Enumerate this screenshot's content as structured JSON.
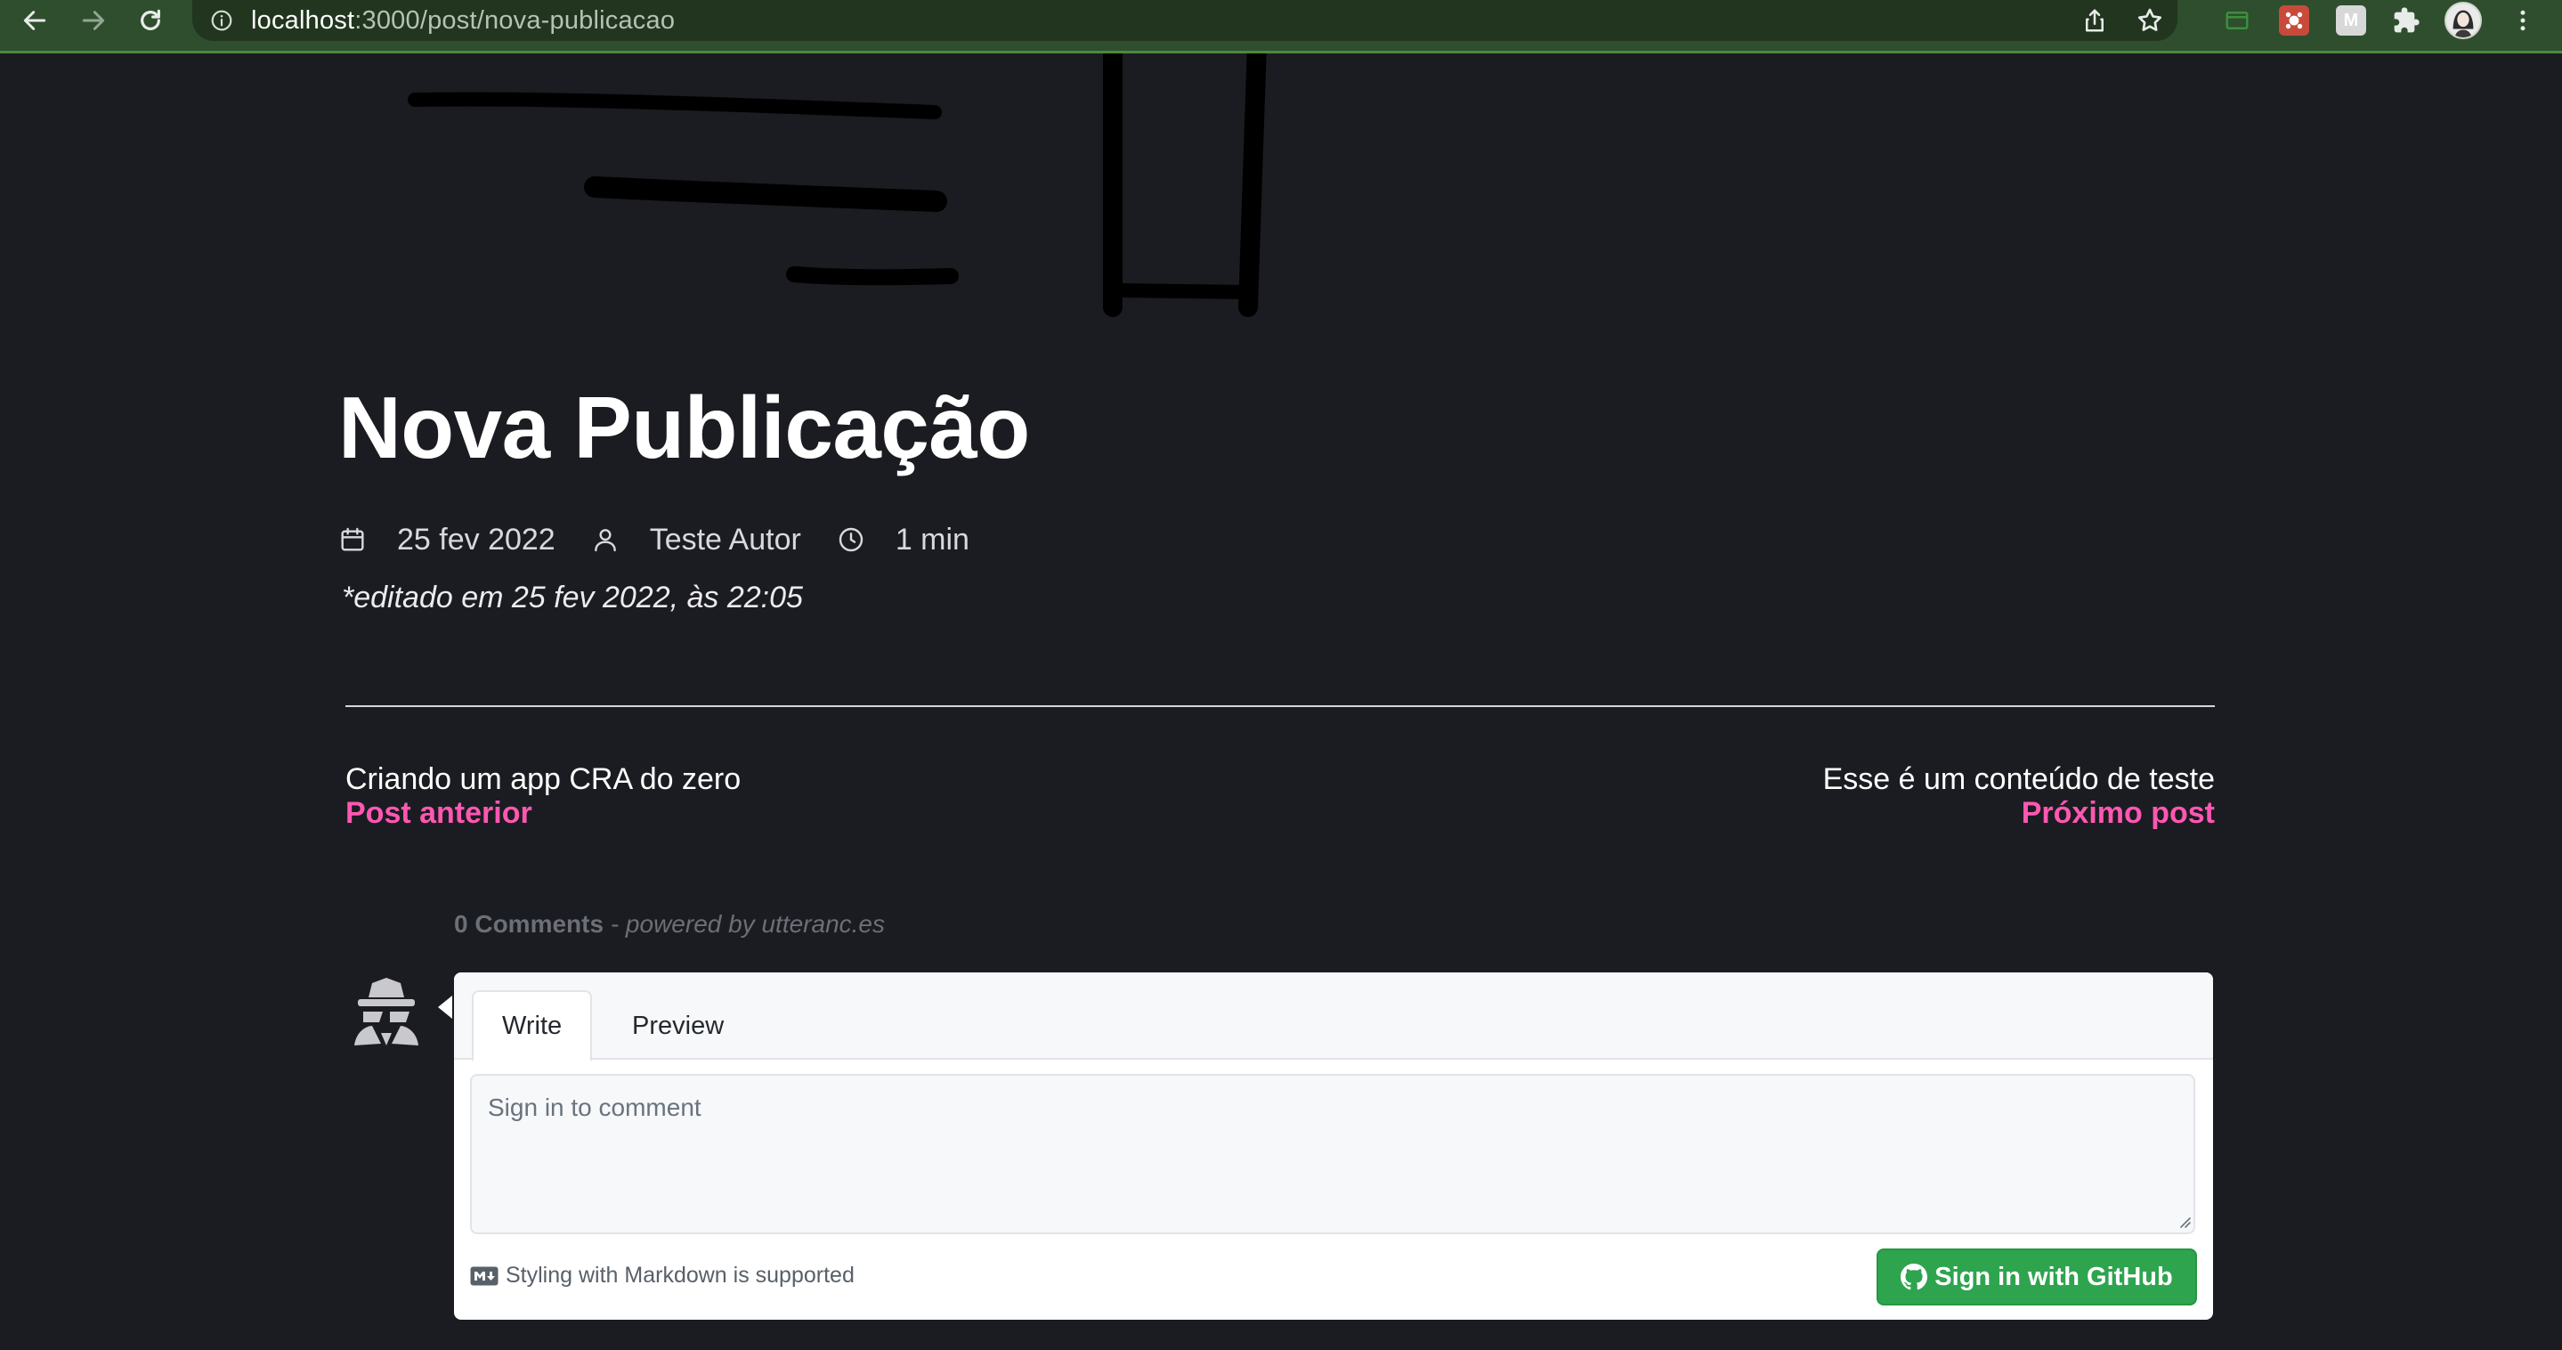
{
  "browser": {
    "url_host": "localhost",
    "url_path": ":3000/post/nova-publicacao",
    "extensions": [
      {
        "name": "tab-search-icon",
        "label": ""
      },
      {
        "name": "extension-red-icon",
        "label": ""
      },
      {
        "name": "extension-m-icon",
        "label": "M"
      },
      {
        "name": "puzzle-icon",
        "label": ""
      }
    ]
  },
  "post": {
    "title": "Nova Publicação",
    "date": "25 fev 2022",
    "author": "Teste Autor",
    "reading_time": "1 min",
    "edited_note": "*editado em 25 fev 2022, às 22:05"
  },
  "navigation": {
    "previous": {
      "title": "Criando um app CRA do zero",
      "label": "Post anterior"
    },
    "next": {
      "title": "Esse é um conteúdo de teste",
      "label": "Próximo post"
    }
  },
  "comments": {
    "count_label": "0 Comments",
    "powered_by": " - powered by utteranc.es",
    "tabs": {
      "write": "Write",
      "preview": "Preview"
    },
    "placeholder": "Sign in to comment",
    "markdown_note": "Styling with Markdown is supported",
    "signin_button": "Sign in with GitHub"
  },
  "colors": {
    "background": "#1b1c21",
    "accent": "#ff57b2",
    "chrome": "#2e4e2e",
    "github_button": "#2ea44f"
  }
}
